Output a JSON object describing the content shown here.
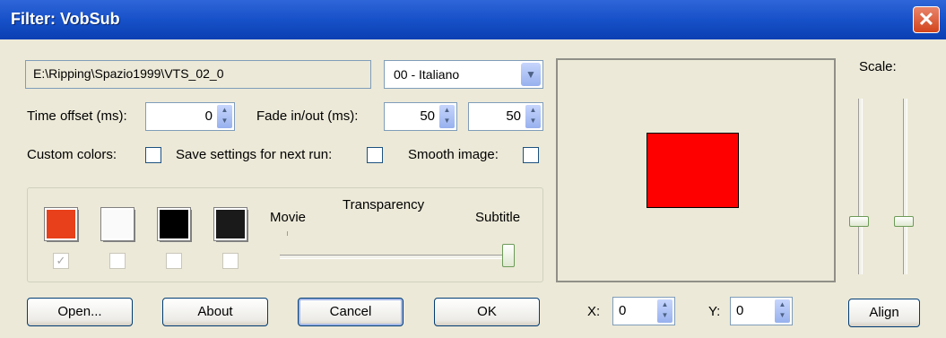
{
  "window": {
    "title": "Filter: VobSub",
    "close_glyph": "✕"
  },
  "source": {
    "path": "E:\\Ripping\\Spazio1999\\VTS_02_0",
    "language": "00 - Italiano"
  },
  "timing": {
    "time_offset_label": "Time offset (ms):",
    "time_offset_value": "0",
    "fade_label": "Fade in/out (ms):",
    "fade_in_value": "50",
    "fade_out_value": "50"
  },
  "options": {
    "custom_colors_label": "Custom colors:",
    "save_settings_label": "Save settings for next run:",
    "smooth_image_label": "Smooth image:"
  },
  "colors": {
    "swatches": [
      {
        "name": "color-1",
        "color": "#e8401a",
        "checked": true
      },
      {
        "name": "color-2",
        "color": "#fafafa",
        "checked": false
      },
      {
        "name": "color-3",
        "color": "#000000",
        "checked": false
      },
      {
        "name": "color-4",
        "color": "#1a1a1a",
        "checked": false
      }
    ]
  },
  "transparency": {
    "title": "Transparency",
    "left_label": "Movie",
    "right_label": "Subtitle",
    "level": 1.0
  },
  "scale": {
    "label": "Scale:",
    "left_level": 0.3,
    "right_level": 0.3
  },
  "position": {
    "x_label": "X:",
    "x_value": "0",
    "y_label": "Y:",
    "y_value": "0"
  },
  "buttons": {
    "open": "Open...",
    "about": "About",
    "cancel": "Cancel",
    "ok": "OK",
    "align": "Align"
  },
  "glyphs": {
    "check": "✓",
    "dropdown": "▼",
    "up": "▲",
    "down": "▼"
  }
}
